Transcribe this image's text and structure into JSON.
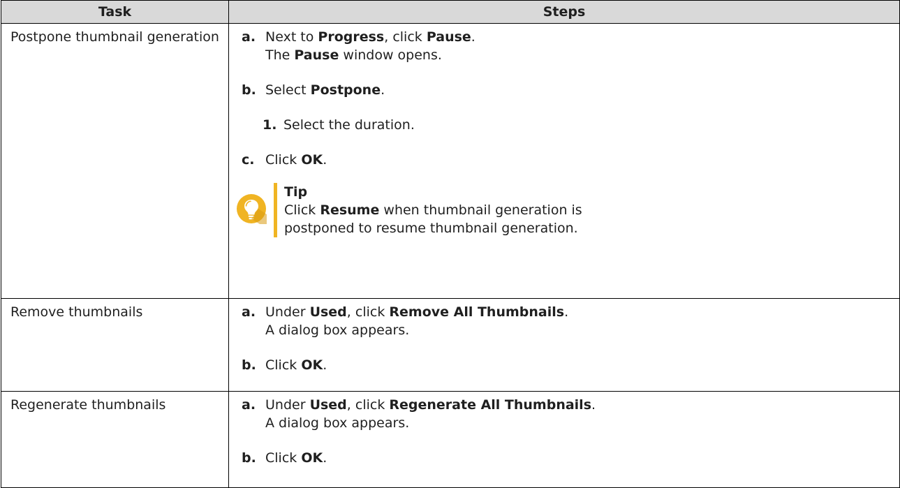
{
  "table": {
    "headers": {
      "task": "Task",
      "steps": "Steps"
    },
    "rows": [
      {
        "task": "Postpone thumbnail generation",
        "steps": [
          {
            "marker": "a.",
            "lines": [
              [
                {
                  "t": "Next to ",
                  "b": false
                },
                {
                  "t": "Progress",
                  "b": true
                },
                {
                  "t": ", click ",
                  "b": false
                },
                {
                  "t": "Pause",
                  "b": true
                },
                {
                  "t": ".",
                  "b": false
                }
              ],
              [
                {
                  "t": "The ",
                  "b": false
                },
                {
                  "t": "Pause",
                  "b": true
                },
                {
                  "t": " window opens.",
                  "b": false
                }
              ]
            ]
          },
          {
            "marker": "b.",
            "lines": [
              [
                {
                  "t": "Select ",
                  "b": false
                },
                {
                  "t": "Postpone",
                  "b": true
                },
                {
                  "t": ".",
                  "b": false
                }
              ]
            ]
          },
          {
            "marker": "1.",
            "sub": true,
            "lines": [
              [
                {
                  "t": "Select the duration.",
                  "b": false
                }
              ]
            ]
          },
          {
            "marker": "c.",
            "lines": [
              [
                {
                  "t": "Click ",
                  "b": false
                },
                {
                  "t": "OK",
                  "b": true
                },
                {
                  "t": ".",
                  "b": false
                }
              ]
            ]
          }
        ],
        "tip": {
          "icon": "lightbulb-icon",
          "title": "Tip",
          "lines": [
            [
              {
                "t": "Click ",
                "b": false
              },
              {
                "t": "Resume",
                "b": true
              },
              {
                "t": " when thumbnail generation is",
                "b": false
              }
            ],
            [
              {
                "t": "postponed to resume thumbnail generation.",
                "b": false
              }
            ]
          ]
        }
      },
      {
        "task": "Remove thumbnails",
        "steps": [
          {
            "marker": "a.",
            "lines": [
              [
                {
                  "t": "Under ",
                  "b": false
                },
                {
                  "t": "Used",
                  "b": true
                },
                {
                  "t": ", click ",
                  "b": false
                },
                {
                  "t": "Remove All Thumbnails",
                  "b": true
                },
                {
                  "t": ".",
                  "b": false
                }
              ],
              [
                {
                  "t": "A dialog box appears.",
                  "b": false
                }
              ]
            ]
          },
          {
            "marker": "b.",
            "lines": [
              [
                {
                  "t": "Click ",
                  "b": false
                },
                {
                  "t": "OK",
                  "b": true
                },
                {
                  "t": ".",
                  "b": false
                }
              ]
            ]
          }
        ]
      },
      {
        "task": "Regenerate thumbnails",
        "steps": [
          {
            "marker": "a.",
            "lines": [
              [
                {
                  "t": "Under ",
                  "b": false
                },
                {
                  "t": "Used",
                  "b": true
                },
                {
                  "t": ", click ",
                  "b": false
                },
                {
                  "t": "Regenerate All Thumbnails",
                  "b": true
                },
                {
                  "t": ".",
                  "b": false
                }
              ],
              [
                {
                  "t": "A dialog box appears.",
                  "b": false
                }
              ]
            ]
          },
          {
            "marker": "b.",
            "lines": [
              [
                {
                  "t": "Click ",
                  "b": false
                },
                {
                  "t": "OK",
                  "b": true
                },
                {
                  "t": ".",
                  "b": false
                }
              ]
            ]
          }
        ]
      }
    ]
  },
  "colors": {
    "header_bg": "#d9d9d9",
    "tip_accent": "#f0b423",
    "tip_icon": "#f0b423",
    "border": "#000000"
  }
}
